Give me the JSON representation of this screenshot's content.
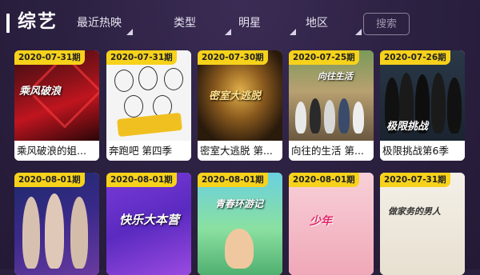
{
  "header": {
    "title": "综艺",
    "nav": [
      {
        "label": "最近热映"
      },
      {
        "label": "类型"
      },
      {
        "label": "明星"
      },
      {
        "label": "地区"
      }
    ],
    "search_label": "搜索"
  },
  "cards": [
    {
      "date": "2020-07-31期",
      "title": "乘风破浪的姐..."
    },
    {
      "date": "2020-07-31期",
      "title": "奔跑吧 第四季"
    },
    {
      "date": "2020-07-30期",
      "title": "密室大逃脱 第..."
    },
    {
      "date": "2020-07-25期",
      "title": "向往的生活 第..."
    },
    {
      "date": "2020-07-26期",
      "title": "极限挑战第6季"
    },
    {
      "date": "2020-08-01期",
      "title": ""
    },
    {
      "date": "2020-08-01期",
      "title": ""
    },
    {
      "date": "2020-08-01期",
      "title": ""
    },
    {
      "date": "2020-08-01期",
      "title": ""
    },
    {
      "date": "2020-07-31期",
      "title": ""
    }
  ],
  "posters": {
    "p1_text": "乘风破浪",
    "p3_text": "密室大逃脱",
    "p4_text": "向往生活",
    "p5_text": "极限挑战",
    "p7_text": "快乐大本营",
    "p8_text": "青春环游记",
    "p9_text": "少年",
    "p10_text": "做家务的男人"
  },
  "colors": {
    "date_badge": "#f7d21b",
    "background": "#2b2040"
  }
}
